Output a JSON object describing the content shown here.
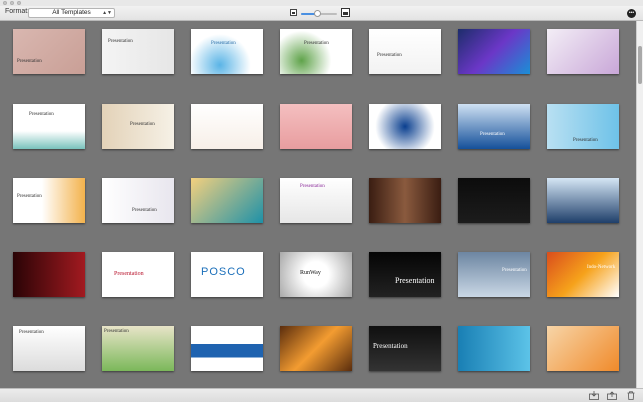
{
  "toolbar": {
    "format_label": "Format:",
    "format_value": "All Templates",
    "zoom_level": 0.45
  },
  "bottom": {
    "icons": [
      "import-icon",
      "export-icon",
      "trash-icon"
    ]
  },
  "colors": {
    "background": "#767676",
    "accent": "#4a90e2"
  },
  "templates": [
    {
      "label": "Presentation"
    },
    {
      "label": "Presentation"
    },
    {
      "label": "Presentation"
    },
    {
      "label": "Presentation"
    },
    {
      "label": "Presentation"
    },
    {
      "label": ""
    },
    {
      "label": ""
    },
    {
      "label": "Presentation"
    },
    {
      "label": "Presentation"
    },
    {
      "label": ""
    },
    {
      "label": ""
    },
    {
      "label": ""
    },
    {
      "label": "Presentation"
    },
    {
      "label": "Presentation"
    },
    {
      "label": "Presentation"
    },
    {
      "label": "Presentation"
    },
    {
      "label": ""
    },
    {
      "label": "Presentation"
    },
    {
      "label": ""
    },
    {
      "label": ""
    },
    {
      "label": ""
    },
    {
      "label": ""
    },
    {
      "label": "Presentation"
    },
    {
      "label": "POSCO"
    },
    {
      "label": "RunWay"
    },
    {
      "label": "Presentation"
    },
    {
      "label": "Presentation"
    },
    {
      "label": "Indo-Network"
    },
    {
      "label": "Presentation"
    },
    {
      "label": "Presentation"
    },
    {
      "label": ""
    },
    {
      "label": ""
    },
    {
      "label": "Presentation"
    },
    {
      "label": ""
    },
    {
      "label": ""
    }
  ]
}
